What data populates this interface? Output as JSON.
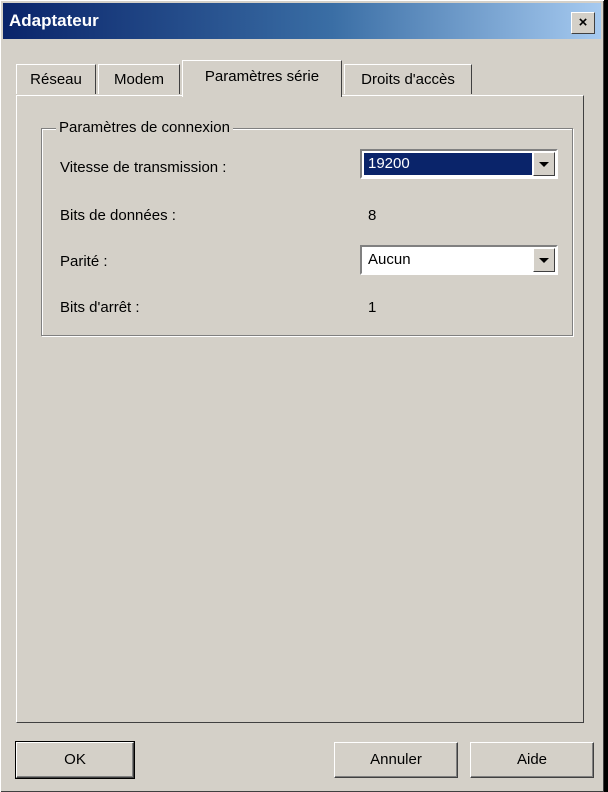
{
  "window": {
    "title": "Adaptateur",
    "close_label": "×"
  },
  "tabs": [
    {
      "label": "Réseau"
    },
    {
      "label": "Modem"
    },
    {
      "label": "Paramètres série"
    },
    {
      "label": "Droits d'accès"
    }
  ],
  "active_tab": "Paramètres série",
  "group": {
    "legend": "Paramètres de connexion",
    "speed_label": "Vitesse de transmission :",
    "speed_value": "19200",
    "data_bits_label": "Bits de données :",
    "data_bits_value": "8",
    "parity_label": "Parité :",
    "parity_value": "Aucun",
    "stop_bits_label": "Bits d'arrêt :",
    "stop_bits_value": "1"
  },
  "buttons": {
    "ok": "OK",
    "cancel": "Annuler",
    "help": "Aide"
  },
  "colors": {
    "title_bar": "#0a246a",
    "face": "#d4d0c8",
    "selection": "#0a246a"
  }
}
